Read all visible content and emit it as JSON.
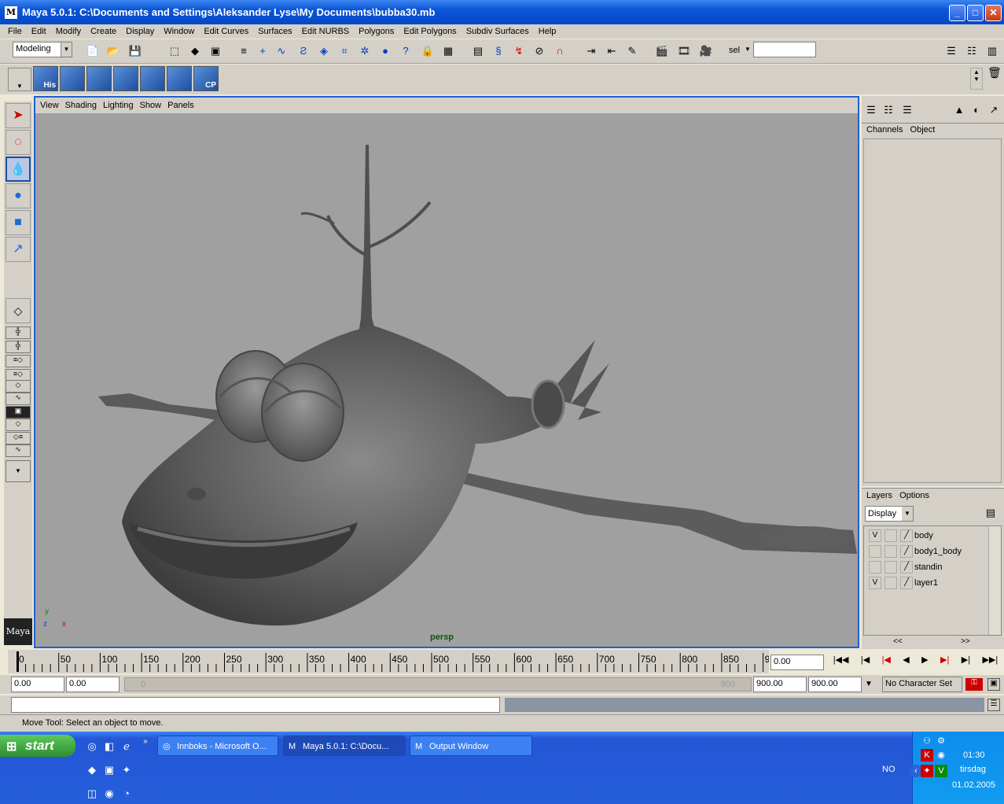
{
  "window": {
    "title": "Maya 5.0.1: C:\\Documents and Settings\\Aleksander Lyse\\My Documents\\bubba30.mb",
    "logo": "M"
  },
  "menus": [
    "File",
    "Edit",
    "Modify",
    "Create",
    "Display",
    "Window",
    "Edit Curves",
    "Surfaces",
    "Edit NURBS",
    "Polygons",
    "Edit Polygons",
    "Subdiv Surfaces",
    "Help"
  ],
  "toolbar": {
    "mode": "Modeling",
    "sel_label": "sel",
    "sel_value": ""
  },
  "shelf": [
    {
      "label": "His"
    },
    {
      "label": ""
    },
    {
      "label": ""
    },
    {
      "label": ""
    },
    {
      "label": ""
    },
    {
      "label": ""
    },
    {
      "label": "CP"
    }
  ],
  "viewport": {
    "menus": [
      "View",
      "Shading",
      "Lighting",
      "Show",
      "Panels"
    ],
    "camera_label": "persp",
    "axis": {
      "y": "y",
      "z": "z",
      "x": "x"
    },
    "logo": "Maya"
  },
  "channel_box": {
    "tabs": [
      "Channels",
      "Object"
    ]
  },
  "layers": {
    "tabs": [
      "Layers",
      "Options"
    ],
    "display_select": "Display",
    "items": [
      {
        "vis": "V",
        "name": "body"
      },
      {
        "vis": "",
        "name": "body1_body"
      },
      {
        "vis": "",
        "name": "standin"
      },
      {
        "vis": "V",
        "name": "layer1"
      }
    ],
    "scroll_left": "<<",
    "scroll_right": ">>"
  },
  "timeline": {
    "ticks": [
      "0",
      "50",
      "100",
      "150",
      "200",
      "250",
      "300",
      "350",
      "400",
      "450",
      "500",
      "550",
      "600",
      "650",
      "700",
      "750",
      "800",
      "850",
      "9"
    ],
    "current_time": "0.00"
  },
  "range": {
    "start": "0.00",
    "anim_start": "0.00",
    "slider_start": "0",
    "slider_end": "900",
    "anim_end": "900.00",
    "end": "900.00",
    "character_set": "No Character Set"
  },
  "help_line": "Move Tool: Select an object to move.",
  "taskbar": {
    "start": "start",
    "tasks": [
      "Innboks - Microsoft O...",
      "Maya 5.0.1: C:\\Docu...",
      "Output Window"
    ],
    "lang": "NO",
    "time": "01:30",
    "day": "tirsdag",
    "date": "01.02.2005"
  }
}
